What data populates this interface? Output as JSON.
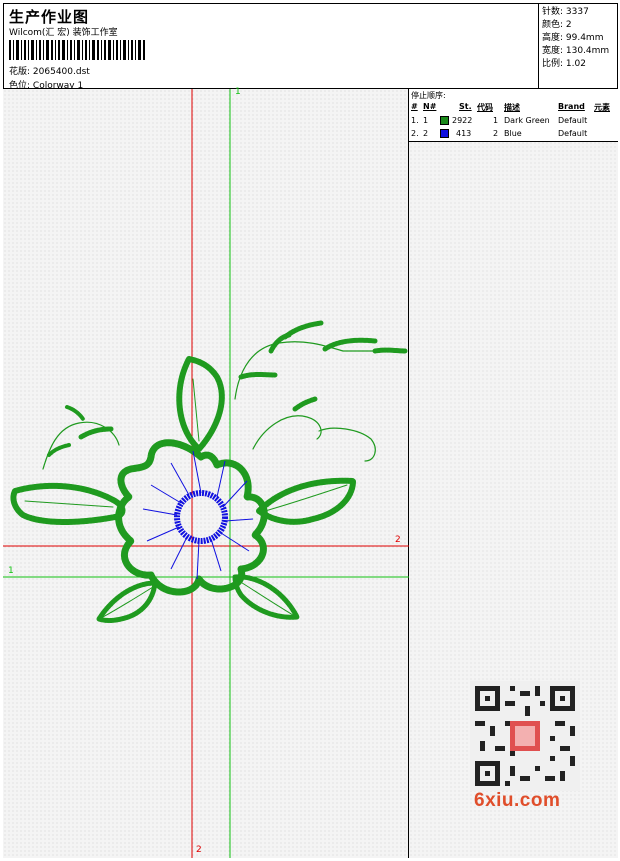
{
  "header": {
    "title": "生产作业图",
    "company": "Wilcom(汇 宏) 装饰工作室",
    "file_label": "花版:",
    "file_name": "2065400.dst",
    "color_label": "色位:",
    "colorway": "Colorway 1"
  },
  "stats": {
    "stitches": "针数: 3337",
    "colors": "颜色: 2",
    "height": "高度: 99.4mm",
    "width": "宽度: 130.4mm",
    "scale": "比例: 1.02"
  },
  "stop_sequence": {
    "title": "停止顺序:",
    "columns": [
      "#",
      "N#",
      "St.",
      "代码",
      "描述",
      "Brand",
      "元素"
    ],
    "rows": [
      {
        "idx": "1.",
        "n": "1",
        "color": "#1a8a1a",
        "st": "2922",
        "code": "1",
        "desc": "Dark Green",
        "brand": "Default"
      },
      {
        "idx": "2.",
        "n": "2",
        "color": "#1010e0",
        "st": "413",
        "code": "2",
        "desc": "Blue",
        "brand": "Default"
      }
    ]
  },
  "axes": {
    "green_v_label": "1",
    "green_h_label": "1",
    "red_h_label": "2",
    "red_v_label": "2"
  },
  "watermark": {
    "text": "6xiu.com"
  }
}
